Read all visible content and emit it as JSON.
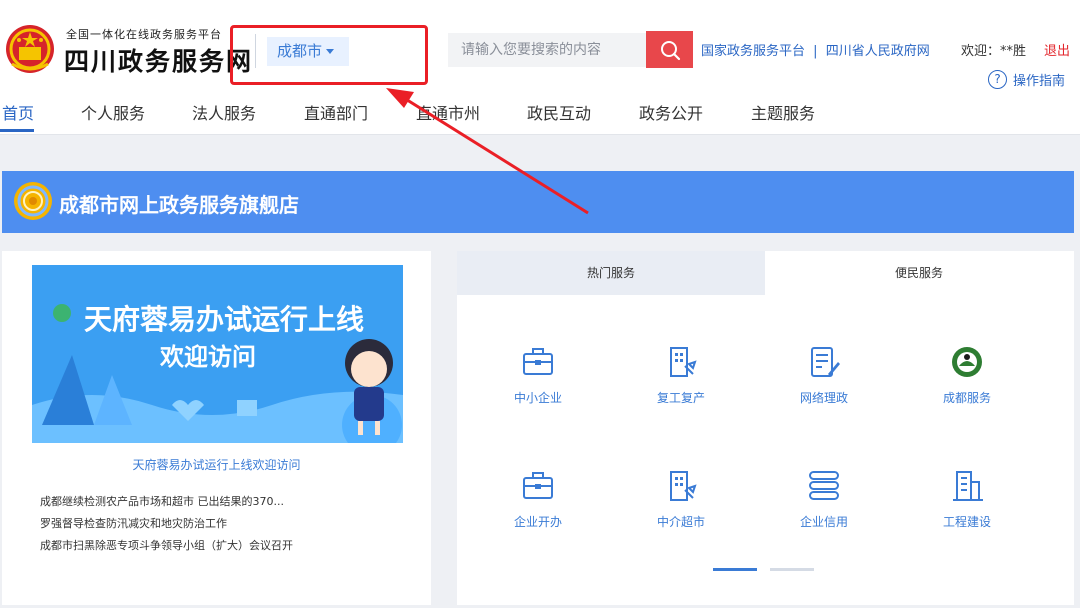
{
  "header": {
    "platform_label": "全国一体化在线政务服务平台",
    "site_title": "四川政务服务网",
    "city": "成都市",
    "search_placeholder": "请输入您要搜索的内容",
    "links": [
      "国家政务服务平台",
      "四川省人民政府网"
    ],
    "link_separator": "|",
    "welcome": "欢迎：**胜",
    "logout": "退出",
    "guide_icon": "?",
    "guide": "操作指南"
  },
  "nav": {
    "items": [
      "首页",
      "个人服务",
      "法人服务",
      "直通部门",
      "直通市州",
      "政民互动",
      "政务公开",
      "主题服务"
    ],
    "active_index": 0
  },
  "banner": {
    "title": "成都市网上政务服务旗舰店"
  },
  "promo": {
    "headline": "天府蓉易办试运行上线",
    "subline": "欢迎访问",
    "caption": "天府蓉易办试运行上线欢迎访问"
  },
  "news": [
    "成都继续检测农产品市场和超市 已出结果的370...",
    "罗强督导检查防汛减灾和地灾防治工作",
    "成都市扫黑除恶专项斗争领导小组（扩大）会议召开"
  ],
  "tabs": [
    "热门服务",
    "便民服务"
  ],
  "active_tab": 1,
  "services": [
    {
      "label": "中小企业",
      "icon": "briefcase-icon"
    },
    {
      "label": "复工复产",
      "icon": "building-tools-icon"
    },
    {
      "label": "网络理政",
      "icon": "document-pen-icon"
    },
    {
      "label": "成都服务",
      "icon": "city-logo-icon"
    },
    {
      "label": "企业开办",
      "icon": "briefcase-icon"
    },
    {
      "label": "中介超市",
      "icon": "building-tools-icon"
    },
    {
      "label": "企业信用",
      "icon": "database-icon"
    },
    {
      "label": "工程建设",
      "icon": "building-icon"
    }
  ],
  "carousel": {
    "active_index": 0,
    "count": 2
  },
  "colors": {
    "brand_blue": "#2a66c4",
    "banner_blue": "#4e8ef0",
    "search_red": "#e8474b",
    "annotation_red": "#ea1f26",
    "icon_blue": "#3a7bd5"
  }
}
